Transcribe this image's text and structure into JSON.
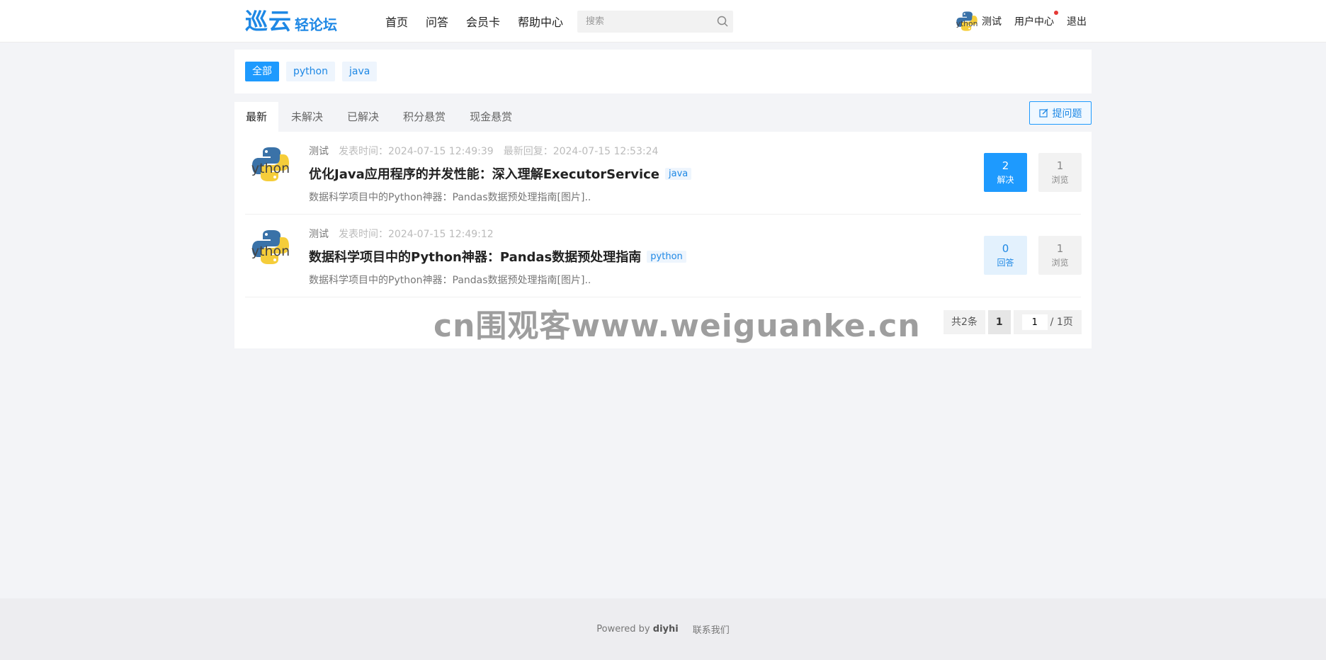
{
  "header": {
    "logo_main": "巡云",
    "logo_sub": "轻论坛",
    "nav": [
      "首页",
      "问答",
      "会员卡",
      "帮助中心"
    ],
    "search_placeholder": "搜索",
    "username": "测试",
    "user_center": "用户中心",
    "logout": "退出"
  },
  "tags": [
    "全部",
    "python",
    "java"
  ],
  "tabs": [
    "最新",
    "未解决",
    "已解决",
    "积分悬赏",
    "现金悬赏"
  ],
  "ask_button": "提问题",
  "questions": [
    {
      "author": "测试",
      "posted": "发表时间：2024-07-15 12:49:39",
      "replied": "最新回复：2024-07-15 12:53:24",
      "title": "优化Java应用程序的并发性能：深入理解ExecutorService",
      "tag": "java",
      "excerpt": "数据科学项目中的Python神器：Pandas数据预处理指南[图片]..",
      "answers": "2",
      "answers_label": "解决",
      "views": "1",
      "views_label": "浏览"
    },
    {
      "author": "测试",
      "posted": "发表时间：2024-07-15 12:49:12",
      "title": "数据科学项目中的Python神器：Pandas数据预处理指南",
      "tag": "python",
      "excerpt": "数据科学项目中的Python神器：Pandas数据预处理指南[图片]..",
      "answers": "0",
      "answers_label": "回答",
      "views": "1",
      "views_label": "浏览"
    }
  ],
  "watermark": "cn围观客www.weiguanke.cn",
  "pagination": {
    "total": "共2条",
    "current": "1",
    "jump_value": "1",
    "pages": "/ 1页"
  },
  "footer": {
    "powered_prefix": "Powered by",
    "powered_brand": "diyhi",
    "contact": "联系我们"
  },
  "colors": {
    "accent": "#1e9afe",
    "accent_light": "#eef5fd",
    "background": "#f3f4f7"
  }
}
